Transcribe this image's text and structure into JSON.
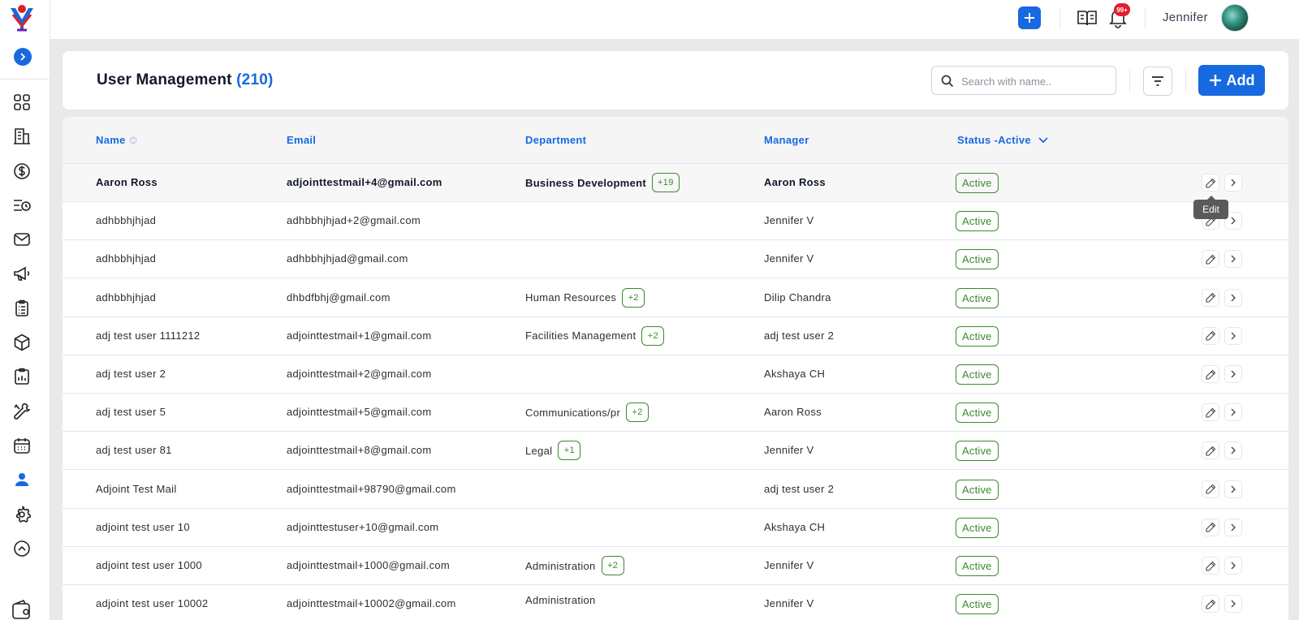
{
  "topbar": {
    "user_name": "Jennifer",
    "notification_badge": "99+"
  },
  "page": {
    "title": "User Management",
    "count": "(210)"
  },
  "search": {
    "placeholder": "Search with name.."
  },
  "add_button": {
    "label": "Add"
  },
  "table": {
    "columns": {
      "name": "Name",
      "email": "Email",
      "department": "Department",
      "manager": "Manager",
      "status": "Status -Active"
    },
    "rows": [
      {
        "name": "Aaron Ross",
        "email": "adjointtestmail+4@gmail.com",
        "department": "Business Development",
        "dept_extra": "+19",
        "manager": "Aaron Ross",
        "status": "Active"
      },
      {
        "name": "adhbbhjhjad",
        "email": "adhbbhjhjad+2@gmail.com",
        "department": "",
        "dept_extra": "",
        "manager": "Jennifer V",
        "status": "Active"
      },
      {
        "name": "adhbbhjhjad",
        "email": "adhbbhjhjad@gmail.com",
        "department": "",
        "dept_extra": "",
        "manager": "Jennifer V",
        "status": "Active"
      },
      {
        "name": "adhbbhjhjad",
        "email": "dhbdfbhj@gmail.com",
        "department": "Human Resources",
        "dept_extra": "+2",
        "manager": "Dilip Chandra",
        "status": "Active"
      },
      {
        "name": "adj test user 1111212",
        "email": "adjointtestmail+1@gmail.com",
        "department": "Facilities Management",
        "dept_extra": "+2",
        "manager": "adj test user 2",
        "status": "Active"
      },
      {
        "name": "adj test user 2",
        "email": "adjointtestmail+2@gmail.com",
        "department": "",
        "dept_extra": "",
        "manager": "Akshaya CH",
        "status": "Active"
      },
      {
        "name": "adj test user 5",
        "email": "adjointtestmail+5@gmail.com",
        "department": "Communications/pr",
        "dept_extra": "+2",
        "manager": "Aaron Ross",
        "status": "Active"
      },
      {
        "name": "adj test user 81",
        "email": "adjointtestmail+8@gmail.com",
        "department": "Legal",
        "dept_extra": "+1",
        "manager": "Jennifer V",
        "status": "Active"
      },
      {
        "name": "Adjoint Test Mail",
        "email": "adjointtestmail+98790@gmail.com",
        "department": "",
        "dept_extra": "",
        "manager": "adj test user 2",
        "status": "Active"
      },
      {
        "name": "adjoint test user 10",
        "email": "adjointtestuser+10@gmail.com",
        "department": "",
        "dept_extra": "",
        "manager": "Akshaya CH",
        "status": "Active"
      },
      {
        "name": "adjoint test user 1000",
        "email": "adjointtestmail+1000@gmail.com",
        "department": "Administration",
        "dept_extra": "+2",
        "manager": "Jennifer V",
        "status": "Active"
      },
      {
        "name": "adjoint test user 10002",
        "email": "adjointtestmail+10002@gmail.com",
        "department": "Administration",
        "dept_extra": "",
        "manager": "Jennifer V",
        "status": "Active"
      }
    ]
  },
  "tooltip": {
    "text": "Edit"
  },
  "colors": {
    "accent": "#1769e0",
    "active_green": "#3b8a2e",
    "badge_red": "#e11d2e"
  }
}
